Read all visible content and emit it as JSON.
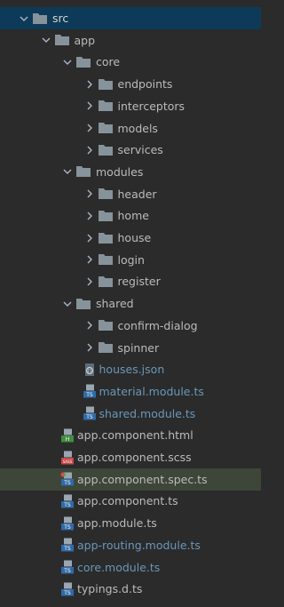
{
  "tree": [
    {
      "label": "src",
      "type": "folder",
      "depth": 0,
      "expanded": true,
      "selected": true
    },
    {
      "label": "app",
      "type": "folder",
      "depth": 1,
      "expanded": true
    },
    {
      "label": "core",
      "type": "folder",
      "depth": 2,
      "expanded": true
    },
    {
      "label": "endpoints",
      "type": "folder",
      "depth": 3,
      "expanded": false
    },
    {
      "label": "interceptors",
      "type": "folder",
      "depth": 3,
      "expanded": false
    },
    {
      "label": "models",
      "type": "folder",
      "depth": 3,
      "expanded": false
    },
    {
      "label": "services",
      "type": "folder",
      "depth": 3,
      "expanded": false
    },
    {
      "label": "modules",
      "type": "folder",
      "depth": 2,
      "expanded": true
    },
    {
      "label": "header",
      "type": "folder",
      "depth": 3,
      "expanded": false
    },
    {
      "label": "home",
      "type": "folder",
      "depth": 3,
      "expanded": false
    },
    {
      "label": "house",
      "type": "folder",
      "depth": 3,
      "expanded": false
    },
    {
      "label": "login",
      "type": "folder",
      "depth": 3,
      "expanded": false
    },
    {
      "label": "register",
      "type": "folder",
      "depth": 3,
      "expanded": false
    },
    {
      "label": "shared",
      "type": "folder",
      "depth": 2,
      "expanded": true
    },
    {
      "label": "confirm-dialog",
      "type": "folder",
      "depth": 3,
      "expanded": false
    },
    {
      "label": "spinner",
      "type": "folder",
      "depth": 3,
      "expanded": false
    },
    {
      "label": "houses.json",
      "type": "file",
      "icon": "json-file-icon",
      "depth": 3,
      "color": "blue"
    },
    {
      "label": "material.module.ts",
      "type": "file",
      "icon": "ts-file-icon",
      "depth": 3,
      "color": "blue"
    },
    {
      "label": "shared.module.ts",
      "type": "file",
      "icon": "ts-file-icon",
      "depth": 3,
      "color": "blue"
    },
    {
      "label": "app.component.html",
      "type": "file",
      "icon": "html-file-icon",
      "depth": 2,
      "color": "default"
    },
    {
      "label": "app.component.scss",
      "type": "file",
      "icon": "sass-file-icon",
      "depth": 2,
      "color": "default"
    },
    {
      "label": "app.component.spec.ts",
      "type": "file",
      "icon": "ts-spec-file-icon",
      "depth": 2,
      "color": "default",
      "highlighted": true
    },
    {
      "label": "app.component.ts",
      "type": "file",
      "icon": "ts-file-icon",
      "depth": 2,
      "color": "default"
    },
    {
      "label": "app.module.ts",
      "type": "file",
      "icon": "ts-file-icon",
      "depth": 2,
      "color": "default"
    },
    {
      "label": "app-routing.module.ts",
      "type": "file",
      "icon": "ts-file-icon",
      "depth": 2,
      "color": "blue"
    },
    {
      "label": "core.module.ts",
      "type": "file",
      "icon": "ts-file-icon",
      "depth": 2,
      "color": "blue"
    },
    {
      "label": "typings.d.ts",
      "type": "file",
      "icon": "ts-file-icon",
      "depth": 2,
      "color": "default"
    }
  ],
  "colors": {
    "background": "#2b2b2b",
    "selection": "#0d3a58",
    "highlight": "#3d4639",
    "folder": "#87939a",
    "text": "#bbbbbb",
    "modified_text": "#6897bb",
    "ts_badge": "#2f6ba8",
    "html_badge": "#3f8e3f",
    "sass_badge": "#c64a4a"
  }
}
